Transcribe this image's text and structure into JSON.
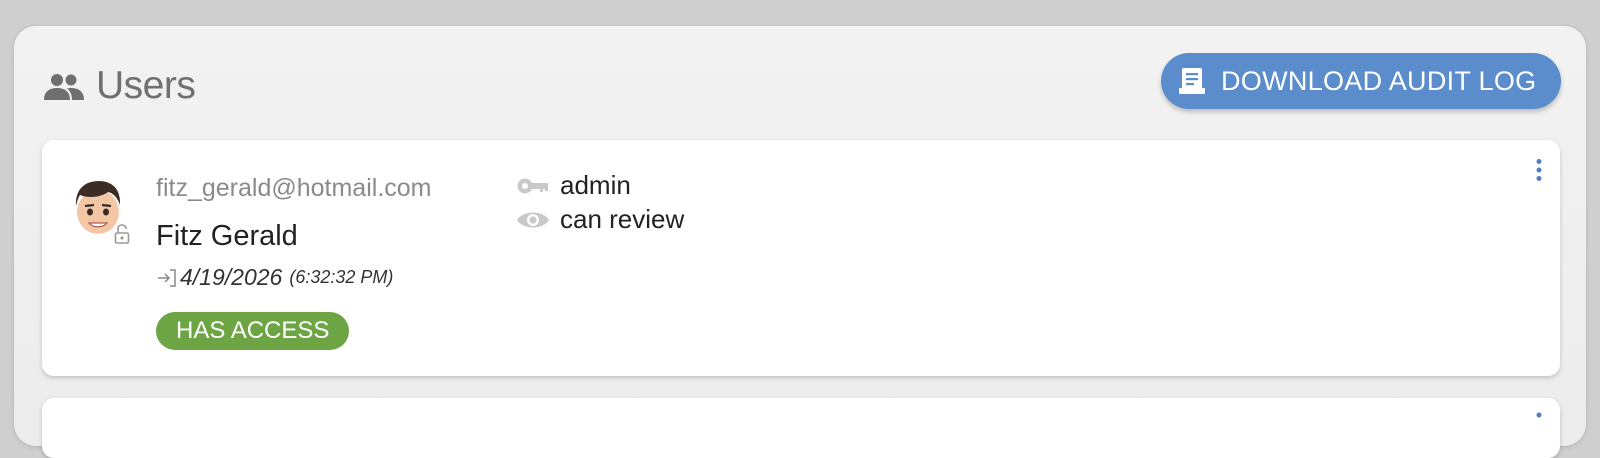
{
  "header": {
    "title": "Users",
    "title_icon": "people-icon",
    "download_button": {
      "label": "DOWNLOAD AUDIT LOG",
      "icon": "receipt-icon",
      "color": "#5b8dcc"
    }
  },
  "users": [
    {
      "email": "fitz_gerald@hotmail.com",
      "name": "Fitz Gerald",
      "last_login_date": "4/19/2026",
      "last_login_time": "(6:32:32 PM)",
      "status": "HAS ACCESS",
      "status_color": "#6ea544",
      "permissions": [
        {
          "label": "admin",
          "icon": "key-icon"
        },
        {
          "label": "can review",
          "icon": "eye-icon"
        }
      ]
    }
  ]
}
